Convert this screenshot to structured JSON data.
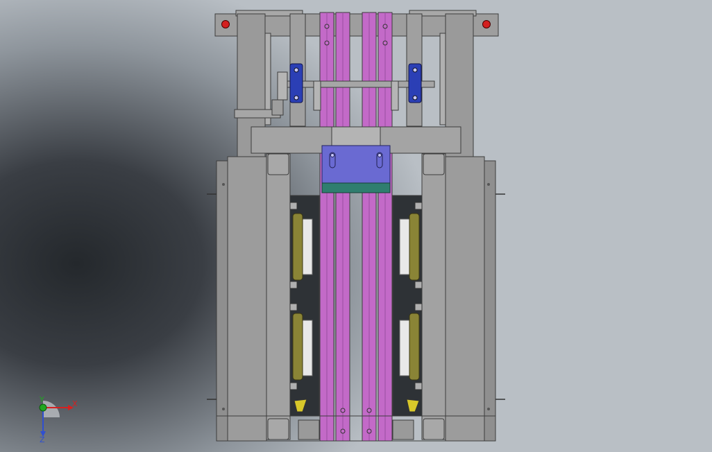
{
  "viewport": {
    "background_center": "#24282c",
    "background_edge": "#b9bfc5"
  },
  "colors": {
    "frame": "#9c9c9c",
    "frame_dark": "#7d7d7d",
    "outline": "#3c3c3c",
    "rail_magenta": "#c36ac8",
    "bearing_blue": "#2b3fb5",
    "plate_lavender": "#6a6ad2",
    "plate_teal": "#2f7e6f",
    "pad_olive": "#8a8436",
    "pad_yellow": "#d8c82a",
    "hole_red": "#d42020",
    "shaft": "#a6a6a6"
  },
  "triad": {
    "x_label": "X",
    "y_label": "Y",
    "z_label": "Z",
    "x_color": "#d62020",
    "y_color": "#1fa61f",
    "z_color": "#2f4fd1"
  }
}
